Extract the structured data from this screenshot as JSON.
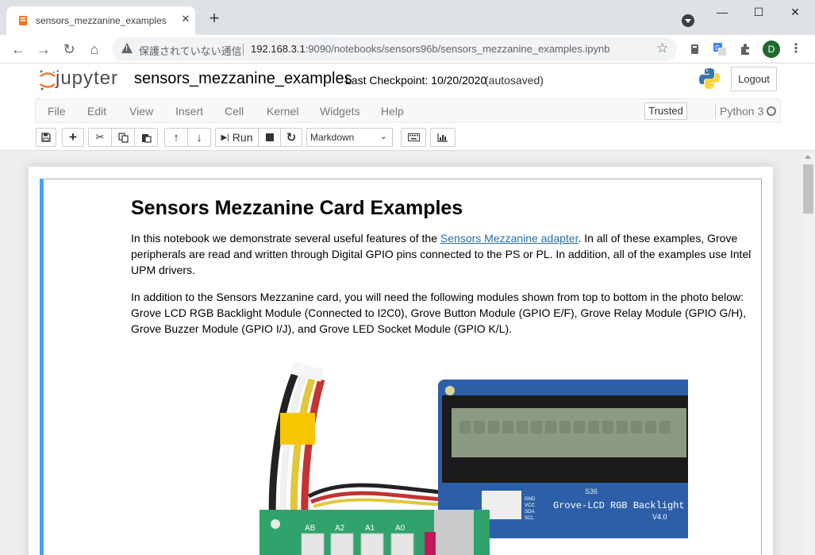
{
  "browser": {
    "tab_title": "sensors_mezzanine_examples",
    "tab_close": "✕",
    "new_tab": "+",
    "window_minimize": "—",
    "window_maximize": "☐",
    "window_close": "✕",
    "security_text": "保護されていない通信",
    "url_host": "192.168.3.1",
    "url_rest": ":9090/notebooks/sensors96b/sensors_mezzanine_examples.ipynb",
    "profile_initial": "D"
  },
  "jupyter": {
    "logo_text": "jupyter",
    "notebook_title": "sensors_mezzanine_examples",
    "checkpoint": "Last Checkpoint: 10/20/2020",
    "autosaved": "(autosaved)",
    "logout_label": "Logout",
    "menu": [
      "File",
      "Edit",
      "View",
      "Insert",
      "Cell",
      "Kernel",
      "Widgets",
      "Help"
    ],
    "trusted_label": "Trusted",
    "kernel_name": "Python 3",
    "run_label": "Run",
    "cell_type": "Markdown"
  },
  "cell": {
    "heading": "Sensors Mezzanine Card Examples",
    "p1_before": "In this notebook we demonstrate several useful features of the ",
    "p1_link": "Sensors Mezzanine adapter",
    "p1_after": ". In all of these examples, Grove peripherals are read and written through Digital GPIO pins connected to the PS or PL. In addition, all of the examples use Intel UPM drivers.",
    "p2": "In addition to the Sensors Mezzanine card, you will need the following modules shown from top to bottom in the photo below: Grove LCD RGB Backlight Module (Connected to I2C0), Grove Button Module (GPIO E/F), Grove Relay Module (GPIO G/H), Grove Buzzer Module (GPIO I/J), and Grove LED Socket Module (GPIO K/L).",
    "photo_text": {
      "lcd_label": "Grove-LCD RGB Backlight",
      "lcd_version": "V4.0",
      "lcd_code": "S36",
      "pins": [
        "GND",
        "VCC",
        "SDA",
        "SCL"
      ],
      "ports": [
        "A0",
        "A1",
        "A2",
        "AB"
      ]
    }
  },
  "colors": {
    "cell_accent": "#42a5f5",
    "link": "#296eaa",
    "lcd_board": "#2d5fa8",
    "base_board": "#2fa36b"
  }
}
